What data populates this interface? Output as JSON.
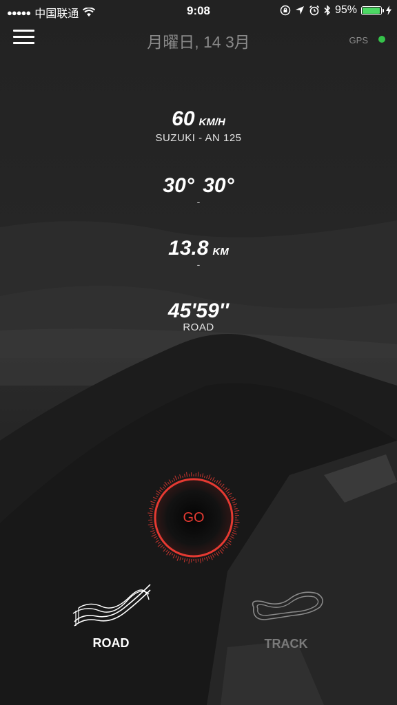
{
  "status_bar": {
    "carrier": "中国联通",
    "time": "9:08",
    "battery": "95%",
    "battery_level": 0.95,
    "icons": [
      "signal-dots-icon",
      "wifi-icon",
      "lock-rotation-icon",
      "location-arrow-icon",
      "alarm-icon",
      "bluetooth-icon",
      "battery-icon",
      "charging-bolt-icon"
    ]
  },
  "header": {
    "menu_icon": "hamburger-menu-icon",
    "date": "月曜日, 14 3月",
    "gps_label": "GPS",
    "gps_status_color": "#35c24a"
  },
  "metrics": {
    "speed": {
      "value": "60",
      "unit": "KM/H",
      "sub": "SUZUKI - AN 125"
    },
    "lean": {
      "left": "30°",
      "right": "30°",
      "sub": "-"
    },
    "distance": {
      "value": "13.8",
      "unit": "KM",
      "sub": "-"
    },
    "duration": {
      "value": "45'59''",
      "sub": "ROAD"
    }
  },
  "go_button": {
    "label": "GO",
    "accent": "#e53a32"
  },
  "modes": {
    "road": {
      "label": "ROAD",
      "icon": "curvy-road-icon",
      "active": true
    },
    "track": {
      "label": "TRACK",
      "icon": "race-track-icon",
      "active": false
    }
  },
  "colors": {
    "accent_red": "#e53a32",
    "inactive": "#7a7a7a"
  }
}
